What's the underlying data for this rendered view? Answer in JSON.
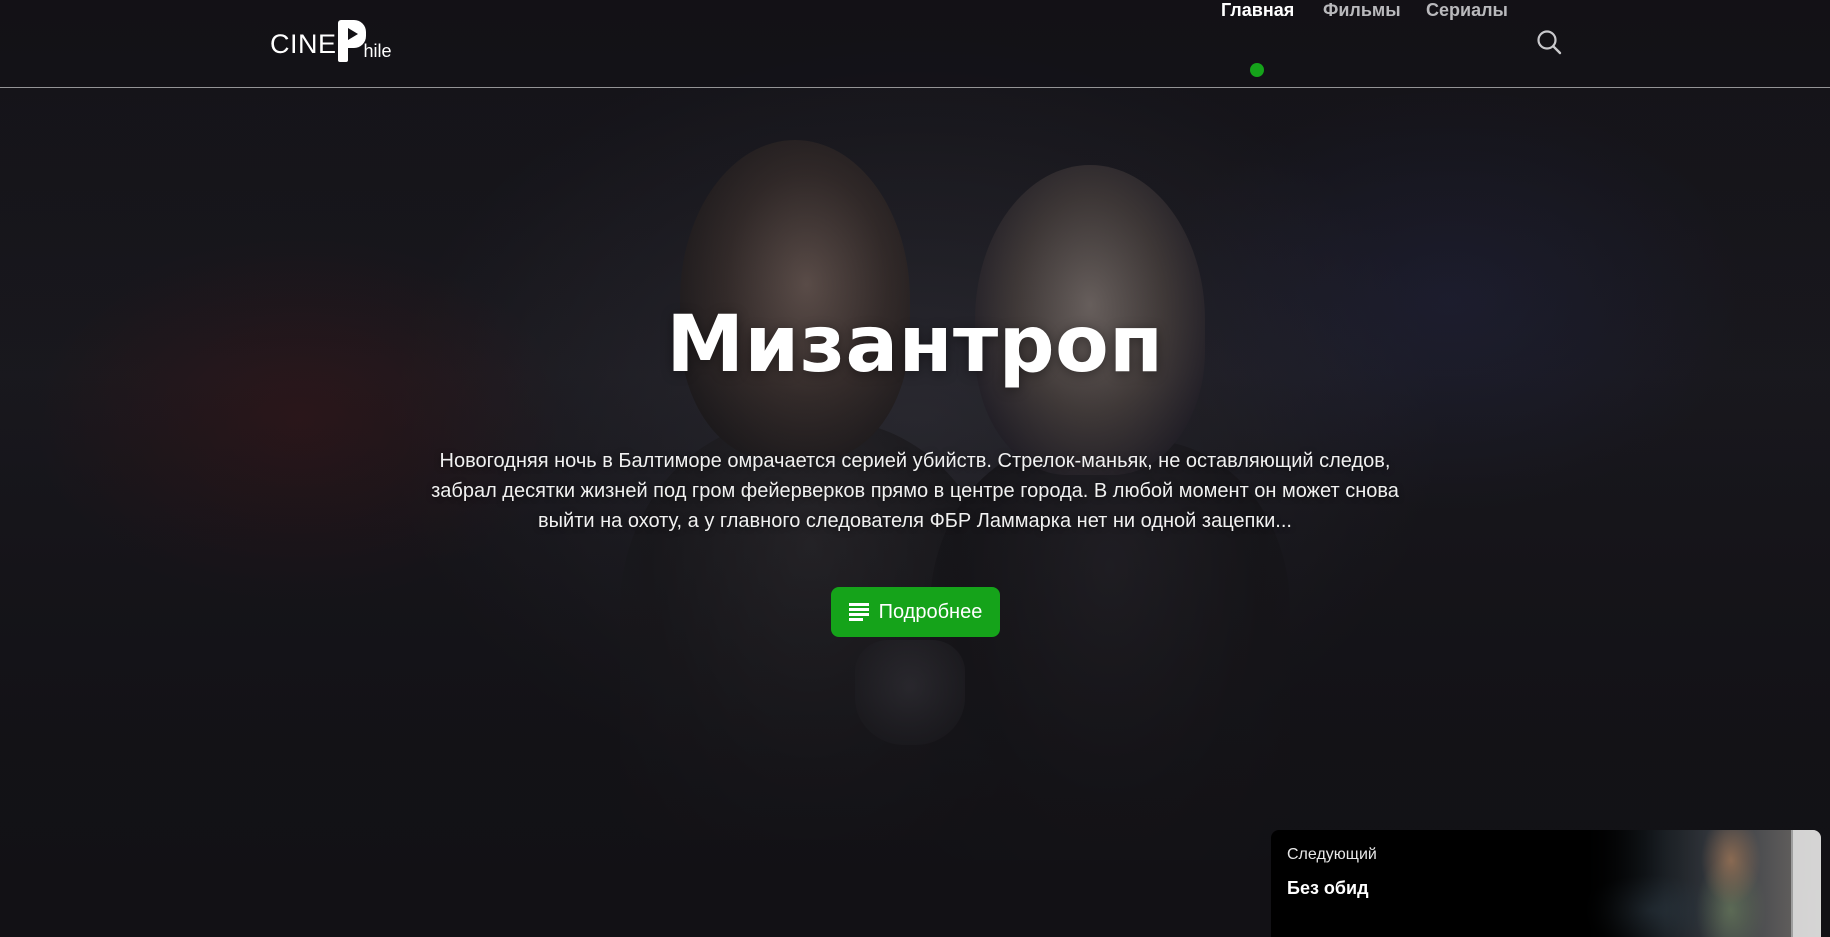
{
  "logo": {
    "cine": "CINE",
    "hile": "hile"
  },
  "nav": {
    "items": [
      {
        "label": "Главная",
        "active": true
      },
      {
        "label": "Фильмы",
        "active": false
      },
      {
        "label": "Сериалы",
        "active": false
      }
    ],
    "search_icon": "search-icon"
  },
  "hero": {
    "title": "Мизантроп",
    "description": "Новогодняя ночь в Балтиморе омрачается серией убийств. Стрелок-маньяк, не оставляющий следов, забрал десятки жизней под гром фейерверков прямо в центре города. В любой момент он может снова выйти на охоту, а у главного следователя ФБР Ламмарка нет ни одной зацепки...",
    "button_label": "Подробнее",
    "button_icon": "list-icon"
  },
  "next": {
    "label": "Следующий",
    "title": "Без обид"
  },
  "colors": {
    "accent": "#15a31a",
    "background": "#121115"
  }
}
